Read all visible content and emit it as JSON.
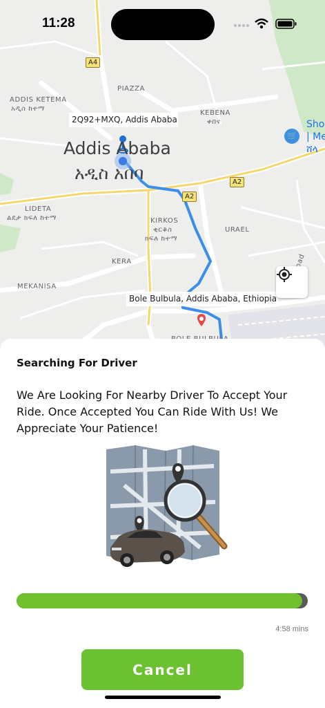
{
  "status_bar": {
    "time": "11:28"
  },
  "map": {
    "labels": {
      "addis_ketema": "ADDIS KETEMA",
      "addis_ketema_am": "አዲስ ከተማ",
      "piazza": "PIAZZA",
      "kebena": "KEBENA",
      "kebena_am": "ቀበና",
      "city_en": "Addis Ababa",
      "city_am": "አዲስ አበባ",
      "lideta": "LIDETA",
      "lideta_am": "ልደታ ክፍለ ከተማ",
      "kirkos": "KIRKOS",
      "kirkos_am1": "ቂርቆስ",
      "kirkos_am2": "ክፍለ ከተማ",
      "urael": "URAEL",
      "kera": "KERA",
      "mekanisa": "MEKANISA",
      "bole_bulbula_area": "BOLE BULBULA",
      "poi_line1": "Sho",
      "poi_line2": "| Me",
      "poi_line3": "ሸላ",
      "road_side": "oad"
    },
    "shields": {
      "a4": "A4",
      "a2_right": "A2",
      "a2_center": "A2"
    },
    "pickup_label": "2Q92+MXQ, Addis Ababa",
    "dropoff_label": "Bole Bulbula, Addis Ababa, Ethiopia",
    "route_color": "#3b8eea",
    "pin_color": "#e24a4a"
  },
  "sheet": {
    "title": "Searching For Driver",
    "message": "We Are Looking For Nearby Driver To Accept Your Ride. Once Accepted You Can Ride With Us! We Appreciate Your Patience!",
    "progress": 0.98,
    "eta": "4:58 mins",
    "cancel_label": "Cancel",
    "accent_color": "#6cc130"
  }
}
